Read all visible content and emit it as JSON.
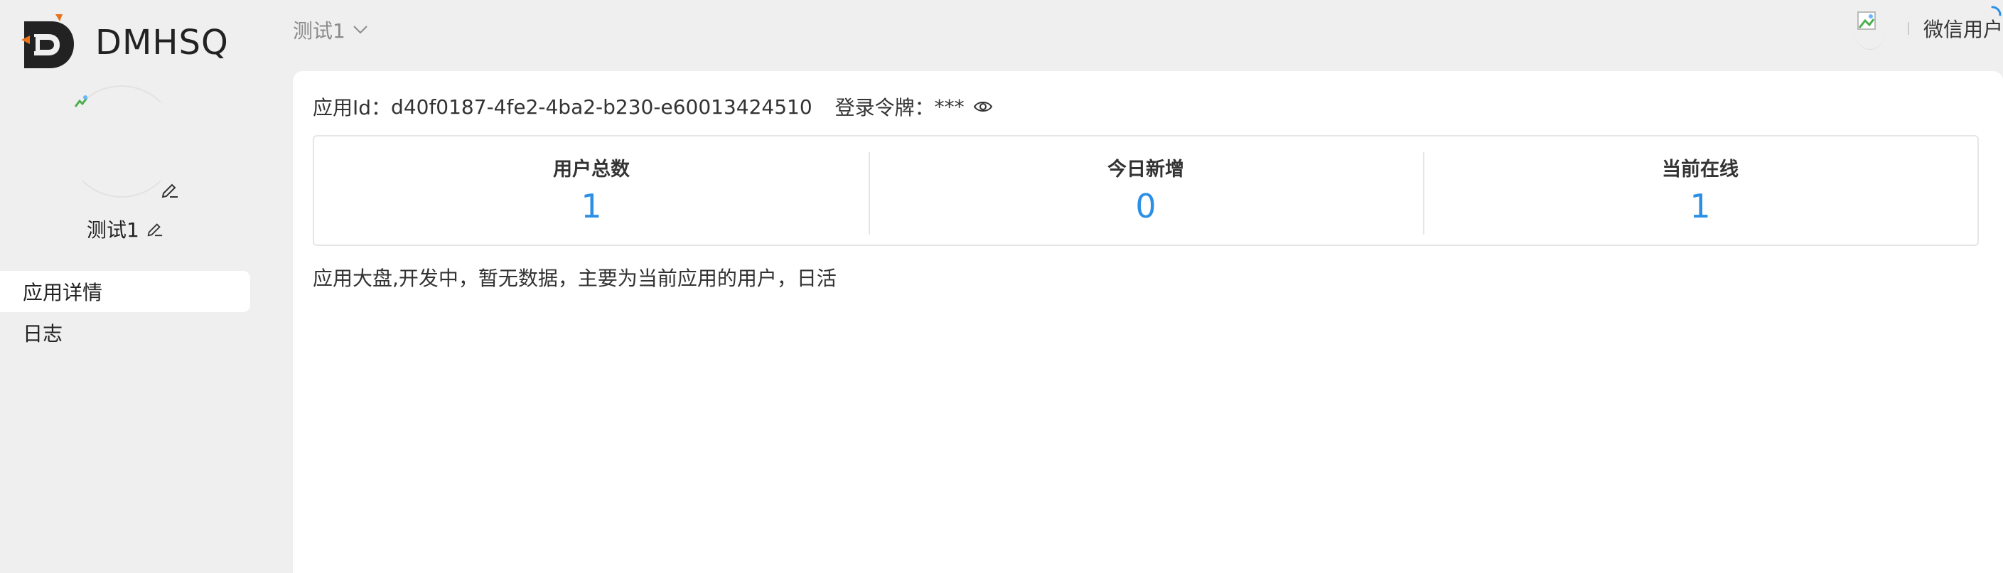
{
  "brand": {
    "name": "DMHSQ"
  },
  "topbar": {
    "app_switch_label": "测试1",
    "user_name": "微信用户"
  },
  "sidebar": {
    "app_name": "测试1",
    "menu": [
      {
        "label": "应用详情",
        "active": true
      },
      {
        "label": "日志",
        "active": false
      }
    ]
  },
  "main": {
    "app_id_label": "应用Id：",
    "app_id_value": "d40f0187-4fe2-4ba2-b230-e60013424510",
    "token_label": "登录令牌：",
    "token_value": "***",
    "stats": [
      {
        "label": "用户总数",
        "value": "1"
      },
      {
        "label": "今日新增",
        "value": "0"
      },
      {
        "label": "当前在线",
        "value": "1"
      }
    ],
    "note": "应用大盘,开发中，暂无数据，主要为当前应用的用户，日活"
  },
  "colors": {
    "accent": "#2b8fe6",
    "logo_dark": "#222222",
    "logo_orange": "#e8731a",
    "background": "#efefef"
  },
  "icons": [
    "logo-icon",
    "chevron-down-icon",
    "broken-image-icon",
    "loading-spinner-icon",
    "edit-icon",
    "eye-icon"
  ]
}
